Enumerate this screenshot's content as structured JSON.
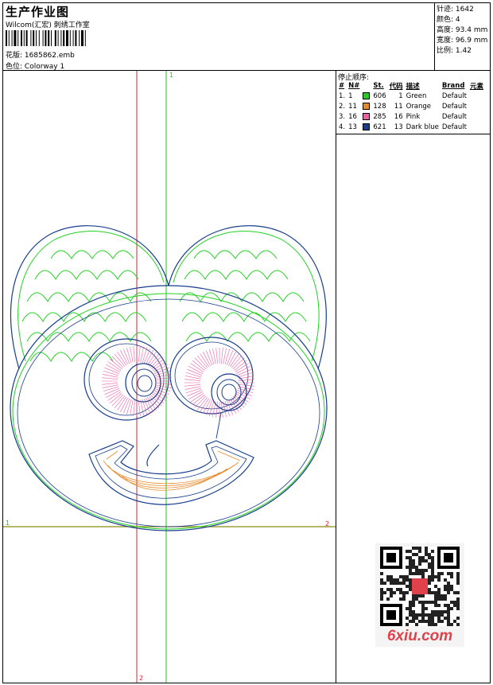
{
  "header": {
    "title": "生产作业图",
    "company": "Wilcom(汇宏) 刺绣工作室",
    "file_label": "花版:",
    "file_name": "1685862.emb",
    "colorway_label": "色位:",
    "colorway": "Colorway 1"
  },
  "stats": [
    {
      "label": "针迹:",
      "value": "1642"
    },
    {
      "label": "颜色:",
      "value": "4"
    },
    {
      "label": "高度:",
      "value": "93.4 mm"
    },
    {
      "label": "宽度:",
      "value": "96.9 mm"
    },
    {
      "label": "比例:",
      "value": "1.42"
    }
  ],
  "stop_sequence": {
    "title": "停止顺序:",
    "columns": [
      "#",
      "N#",
      "St.",
      "代码",
      "描述",
      "Brand",
      "元素"
    ],
    "rows": [
      {
        "index": "1.",
        "n": "1",
        "color": "#1fd11f",
        "stitches": "606",
        "code": "1",
        "desc": "Green",
        "brand": "Default"
      },
      {
        "index": "2.",
        "n": "11",
        "color": "#e8892a",
        "stitches": "128",
        "code": "11",
        "desc": "Orange",
        "brand": "Default"
      },
      {
        "index": "3.",
        "n": "16",
        "color": "#ee5fa7",
        "stitches": "285",
        "code": "16",
        "desc": "Pink",
        "brand": "Default"
      },
      {
        "index": "4.",
        "n": "13",
        "color": "#173d8c",
        "stitches": "621",
        "code": "13",
        "desc": "Dark blue",
        "brand": "Default"
      }
    ]
  },
  "guides": {
    "vertical_green_label": "1",
    "horizontal_left_label": "1",
    "horizontal_right_label": "2",
    "vertical_red_label": "2"
  },
  "colors": {
    "green": "#1fd11f",
    "orange": "#e8892a",
    "pink": "#ee5fa7",
    "dark_blue": "#173d8c",
    "guide_red": "#e0202a",
    "guide_green": "#22c022",
    "guide_olive": "#8c8c10"
  },
  "watermark": {
    "site": "6xiu.com"
  }
}
